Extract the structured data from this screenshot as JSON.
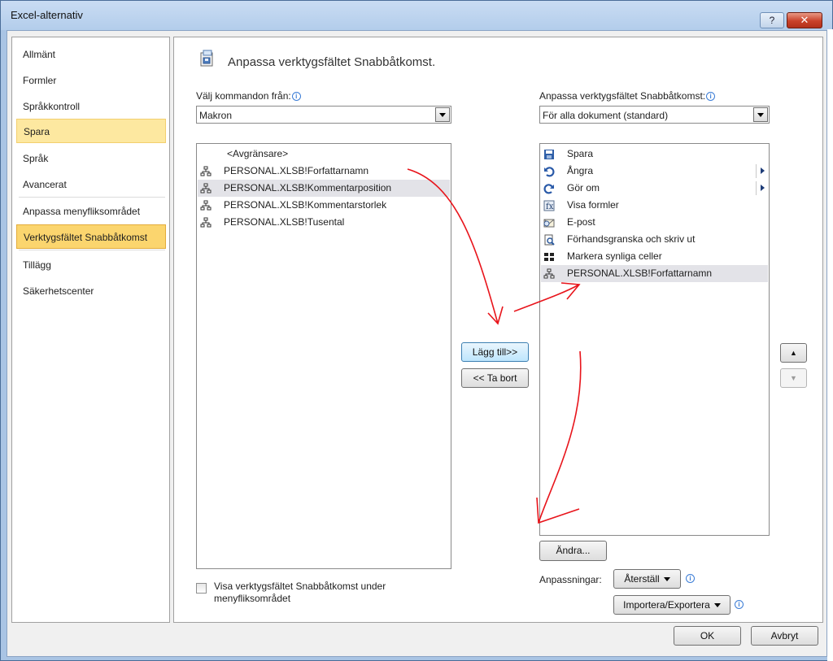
{
  "window": {
    "title": "Excel-alternativ",
    "help_label": "?",
    "close_label": "✕"
  },
  "sidebar": {
    "items": [
      {
        "label": "Allmänt"
      },
      {
        "label": "Formler"
      },
      {
        "label": "Språkkontroll"
      },
      {
        "label": "Spara"
      },
      {
        "label": "Språk"
      },
      {
        "label": "Avancerat"
      },
      {
        "label": "Anpassa menyfliksområdet"
      },
      {
        "label": "Verktygsfältet Snabbåtkomst"
      },
      {
        "label": "Tillägg"
      },
      {
        "label": "Säkerhetscenter"
      }
    ]
  },
  "main": {
    "title": "Anpassa verktygsfältet Snabbåtkomst.",
    "choose_label": "Välj kommandon från:",
    "choose_value": "Makron",
    "customize_label": "Anpassa verktygsfältet Snabbåtkomst:",
    "customize_value": "För alla dokument (standard)",
    "left_list": [
      {
        "label": "<Avgränsare>",
        "icon": "none"
      },
      {
        "label": "PERSONAL.XLSB!Forfattarnamn",
        "icon": "macro-icon"
      },
      {
        "label": "PERSONAL.XLSB!Kommentarposition",
        "icon": "macro-icon"
      },
      {
        "label": "PERSONAL.XLSB!Kommentarstorlek",
        "icon": "macro-icon"
      },
      {
        "label": "PERSONAL.XLSB!Tusental",
        "icon": "macro-icon"
      }
    ],
    "right_list": [
      {
        "label": "Spara",
        "icon": "save-icon"
      },
      {
        "label": "Ångra",
        "icon": "undo-icon"
      },
      {
        "label": "Gör om",
        "icon": "redo-icon"
      },
      {
        "label": "Visa formler",
        "icon": "formula-icon"
      },
      {
        "label": "E-post",
        "icon": "email-icon"
      },
      {
        "label": "Förhandsgranska och skriv ut",
        "icon": "print-preview-icon"
      },
      {
        "label": "Markera synliga celler",
        "icon": "visible-cells-icon"
      },
      {
        "label": "PERSONAL.XLSB!Forfattarnamn",
        "icon": "macro-icon"
      }
    ],
    "add_button": "Lägg till>>",
    "remove_button": "<< Ta bort",
    "modify_button": "Ändra...",
    "customizations_label": "Anpassningar:",
    "reset_button": "Återställ",
    "import_export_button": "Importera/Exportera",
    "show_below_line1": "Visa verktygsfältet Snabbåtkomst under",
    "show_below_line2": "menyfliksområdet",
    "up_label": "▲",
    "down_label": "▼"
  },
  "footer": {
    "ok_button": "OK",
    "cancel_button": "Avbryt"
  },
  "colors": {
    "selected_nav": "#fbd56e",
    "annotation": "#e8141b"
  }
}
